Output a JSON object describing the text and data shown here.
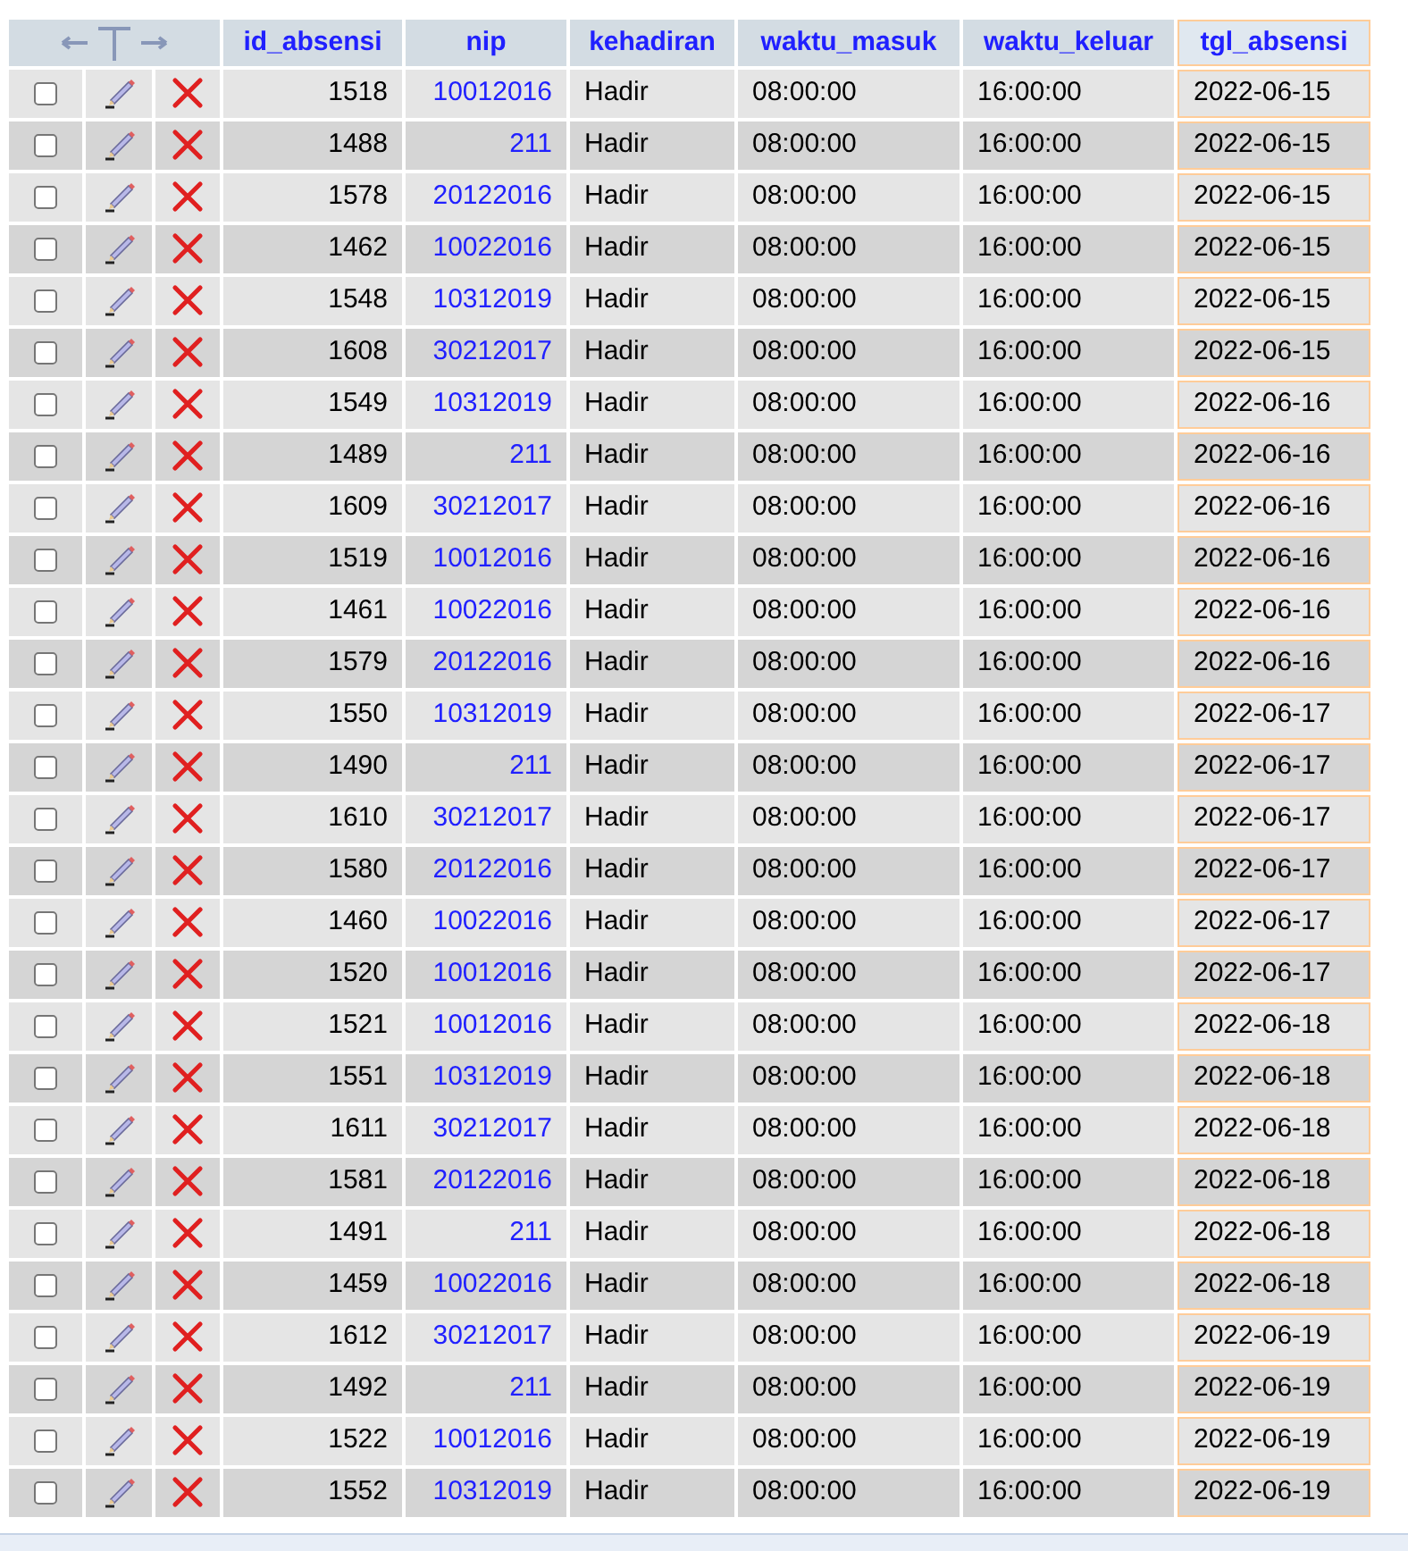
{
  "table": {
    "columns": [
      {
        "label": "id_absensi",
        "sorted": false
      },
      {
        "label": "nip",
        "sorted": false
      },
      {
        "label": "kehadiran",
        "sorted": false
      },
      {
        "label": "waktu_masuk",
        "sorted": false
      },
      {
        "label": "waktu_keluar",
        "sorted": false
      },
      {
        "label": "tgl_absensi",
        "sorted": true
      }
    ],
    "rows": [
      {
        "checked": false,
        "cells": [
          "1518",
          "10012016",
          "Hadir",
          "08:00:00",
          "16:00:00",
          "2022-06-15"
        ]
      },
      {
        "checked": false,
        "cells": [
          "1488",
          "211",
          "Hadir",
          "08:00:00",
          "16:00:00",
          "2022-06-15"
        ]
      },
      {
        "checked": false,
        "cells": [
          "1578",
          "20122016",
          "Hadir",
          "08:00:00",
          "16:00:00",
          "2022-06-15"
        ]
      },
      {
        "checked": false,
        "cells": [
          "1462",
          "10022016",
          "Hadir",
          "08:00:00",
          "16:00:00",
          "2022-06-15"
        ]
      },
      {
        "checked": false,
        "cells": [
          "1548",
          "10312019",
          "Hadir",
          "08:00:00",
          "16:00:00",
          "2022-06-15"
        ]
      },
      {
        "checked": false,
        "cells": [
          "1608",
          "30212017",
          "Hadir",
          "08:00:00",
          "16:00:00",
          "2022-06-15"
        ]
      },
      {
        "checked": false,
        "cells": [
          "1549",
          "10312019",
          "Hadir",
          "08:00:00",
          "16:00:00",
          "2022-06-16"
        ]
      },
      {
        "checked": false,
        "cells": [
          "1489",
          "211",
          "Hadir",
          "08:00:00",
          "16:00:00",
          "2022-06-16"
        ]
      },
      {
        "checked": false,
        "cells": [
          "1609",
          "30212017",
          "Hadir",
          "08:00:00",
          "16:00:00",
          "2022-06-16"
        ]
      },
      {
        "checked": false,
        "cells": [
          "1519",
          "10012016",
          "Hadir",
          "08:00:00",
          "16:00:00",
          "2022-06-16"
        ]
      },
      {
        "checked": false,
        "cells": [
          "1461",
          "10022016",
          "Hadir",
          "08:00:00",
          "16:00:00",
          "2022-06-16"
        ]
      },
      {
        "checked": false,
        "cells": [
          "1579",
          "20122016",
          "Hadir",
          "08:00:00",
          "16:00:00",
          "2022-06-16"
        ]
      },
      {
        "checked": false,
        "cells": [
          "1550",
          "10312019",
          "Hadir",
          "08:00:00",
          "16:00:00",
          "2022-06-17"
        ]
      },
      {
        "checked": false,
        "cells": [
          "1490",
          "211",
          "Hadir",
          "08:00:00",
          "16:00:00",
          "2022-06-17"
        ]
      },
      {
        "checked": false,
        "cells": [
          "1610",
          "30212017",
          "Hadir",
          "08:00:00",
          "16:00:00",
          "2022-06-17"
        ]
      },
      {
        "checked": false,
        "cells": [
          "1580",
          "20122016",
          "Hadir",
          "08:00:00",
          "16:00:00",
          "2022-06-17"
        ]
      },
      {
        "checked": false,
        "cells": [
          "1460",
          "10022016",
          "Hadir",
          "08:00:00",
          "16:00:00",
          "2022-06-17"
        ]
      },
      {
        "checked": false,
        "cells": [
          "1520",
          "10012016",
          "Hadir",
          "08:00:00",
          "16:00:00",
          "2022-06-17"
        ]
      },
      {
        "checked": false,
        "cells": [
          "1521",
          "10012016",
          "Hadir",
          "08:00:00",
          "16:00:00",
          "2022-06-18"
        ]
      },
      {
        "checked": false,
        "cells": [
          "1551",
          "10312019",
          "Hadir",
          "08:00:00",
          "16:00:00",
          "2022-06-18"
        ]
      },
      {
        "checked": false,
        "cells": [
          "1611",
          "30212017",
          "Hadir",
          "08:00:00",
          "16:00:00",
          "2022-06-18"
        ]
      },
      {
        "checked": false,
        "cells": [
          "1581",
          "20122016",
          "Hadir",
          "08:00:00",
          "16:00:00",
          "2022-06-18"
        ]
      },
      {
        "checked": false,
        "cells": [
          "1491",
          "211",
          "Hadir",
          "08:00:00",
          "16:00:00",
          "2022-06-18"
        ]
      },
      {
        "checked": false,
        "cells": [
          "1459",
          "10022016",
          "Hadir",
          "08:00:00",
          "16:00:00",
          "2022-06-18"
        ]
      },
      {
        "checked": false,
        "cells": [
          "1612",
          "30212017",
          "Hadir",
          "08:00:00",
          "16:00:00",
          "2022-06-19"
        ]
      },
      {
        "checked": false,
        "cells": [
          "1492",
          "211",
          "Hadir",
          "08:00:00",
          "16:00:00",
          "2022-06-19"
        ]
      },
      {
        "checked": false,
        "cells": [
          "1522",
          "10012016",
          "Hadir",
          "08:00:00",
          "16:00:00",
          "2022-06-19"
        ]
      },
      {
        "checked": false,
        "cells": [
          "1552",
          "10312019",
          "Hadir",
          "08:00:00",
          "16:00:00",
          "2022-06-19"
        ]
      }
    ]
  }
}
